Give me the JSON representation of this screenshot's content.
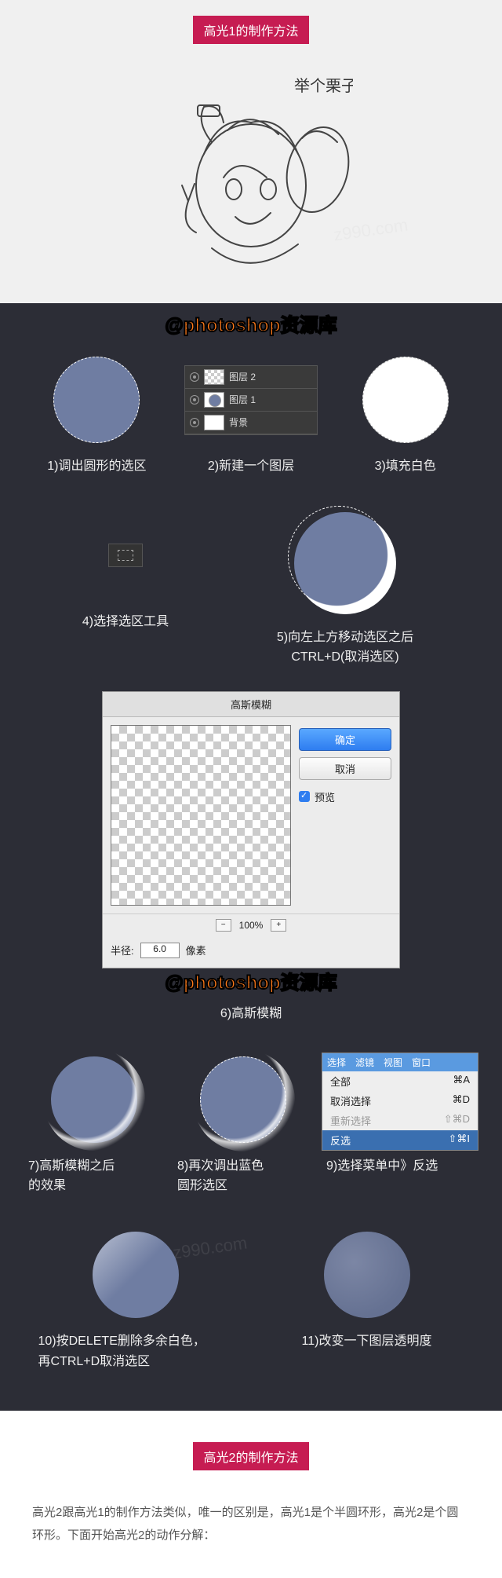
{
  "section1": {
    "title": "高光1的制作方法",
    "sketch_text": "举个栗子!"
  },
  "watermark": {
    "at": "@",
    "body": "photoshop资源库"
  },
  "row1": {
    "step1": "1)调出圆形的选区",
    "step2": "2)新建一个图层",
    "step3": "3)填充白色",
    "layers": {
      "l2": "图层 2",
      "l1": "图层 1",
      "bg": "背景"
    }
  },
  "row2": {
    "step4": "4)选择选区工具",
    "step5_line1": "5)向左上方移动选区之后",
    "step5_line2": "CTRL+D(取消选区)"
  },
  "dialog": {
    "title": "高斯模糊",
    "ok": "确定",
    "cancel": "取消",
    "preview": "预览",
    "zoom": "100%",
    "radius_label": "半径:",
    "radius_value": "6.0",
    "unit": "像素"
  },
  "step6": "6)高斯模糊",
  "row3": {
    "step7_l1": "7)高斯模糊之后",
    "step7_l2": "的效果",
    "step8_l1": "8)再次调出蓝色",
    "step8_l2": "圆形选区",
    "step9": "9)选择菜单中》反选"
  },
  "menu": {
    "head": {
      "select": "选择",
      "filter": "滤镜",
      "view": "视图",
      "window": "窗口"
    },
    "items": {
      "all": {
        "label": "全部",
        "sc": "⌘A"
      },
      "deselect": {
        "label": "取消选择",
        "sc": "⌘D"
      },
      "reselect": {
        "label": "重新选择",
        "sc": "⇧⌘D"
      },
      "inverse": {
        "label": "反选",
        "sc": "⇧⌘I"
      }
    }
  },
  "row4": {
    "step10_l1": "10)按DELETE删除多余白色，",
    "step10_l2": "再CTRL+D取消选区",
    "step11": "11)改变一下图层透明度"
  },
  "section2": {
    "title": "高光2的制作方法",
    "paragraph": "高光2跟高光1的制作方法类似，唯一的区别是，高光1是个半圆环形，高光2是个圆环形。下面开始高光2的动作分解："
  },
  "faint": "z990.com"
}
